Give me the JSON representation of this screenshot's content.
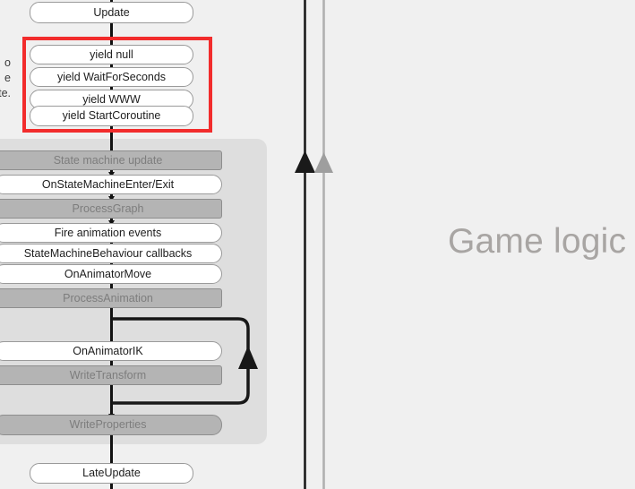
{
  "background": {
    "page_color": "#f0f0f0",
    "panel_color": "#dedede",
    "highlight_color": "#f22c2c",
    "bar_color": "#b4b4b4",
    "bar_text_color": "#7d7d7d",
    "pill_text_color": "#1d1d1d",
    "timeline_black": "#1a1a1a",
    "timeline_gray": "#b0b0b0",
    "big_label_color": "#a8a5a3"
  },
  "caption": {
    "line1": "o",
    "line2": "e",
    "line3": "te."
  },
  "flow": {
    "top_node": {
      "label": "Update",
      "kind": "pill"
    },
    "coroutine_group": {
      "highlighted": true,
      "items": [
        {
          "label": "yield null",
          "kind": "pill"
        },
        {
          "label": "yield WaitForSeconds",
          "kind": "pill"
        },
        {
          "label": "yield WWW",
          "kind": "pill"
        },
        {
          "label": "yield StartCoroutine",
          "kind": "pill"
        }
      ]
    },
    "animation_panel": {
      "items": [
        {
          "label": "State machine update",
          "kind": "bar"
        },
        {
          "label": "OnStateMachineEnter/Exit",
          "kind": "pill"
        },
        {
          "label": "ProcessGraph",
          "kind": "bar"
        },
        {
          "label": "Fire animation events",
          "kind": "pill"
        },
        {
          "label": "StateMachineBehaviour callbacks",
          "kind": "pill"
        },
        {
          "label": "OnAnimatorMove",
          "kind": "pill"
        },
        {
          "label": "ProcessAnimation",
          "kind": "bar"
        },
        {
          "label": "OnAnimatorIK",
          "kind": "pill"
        },
        {
          "label": "WriteTransform",
          "kind": "bar"
        },
        {
          "label": "WriteProperties",
          "kind": "bar-round"
        }
      ],
      "loop_note": "OnAnimatorIK / WriteTransform repeat loop"
    },
    "bottom_node": {
      "label": "LateUpdate",
      "kind": "pill"
    }
  },
  "timelines": [
    {
      "name": "game-logic-timeline-primary",
      "color": "#1a1a1a"
    },
    {
      "name": "game-logic-timeline-secondary",
      "color": "#b0b0b0"
    }
  ],
  "big_label": {
    "text": "Game logic"
  }
}
